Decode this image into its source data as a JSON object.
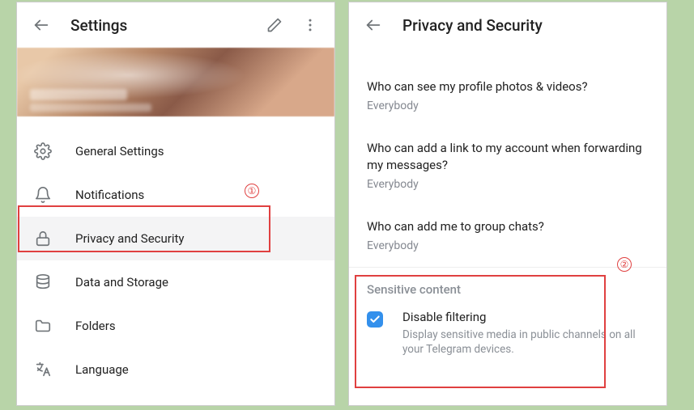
{
  "left": {
    "title": "Settings",
    "menu": [
      {
        "label": "General Settings"
      },
      {
        "label": "Notifications"
      },
      {
        "label": "Privacy and Security"
      },
      {
        "label": "Data and Storage"
      },
      {
        "label": "Folders"
      },
      {
        "label": "Language"
      }
    ]
  },
  "right": {
    "title": "Privacy and Security",
    "privacy": [
      {
        "title": "Who can see my profile photos & videos?",
        "value": "Everybody"
      },
      {
        "title": "Who can add a link to my account when forwarding my messages?",
        "value": "Everybody"
      },
      {
        "title": "Who can add me to group chats?",
        "value": "Everybody"
      }
    ],
    "sensitive": {
      "header": "Sensitive content",
      "title": "Disable filtering",
      "desc": "Display sensitive media in public channels on all your Telegram devices."
    }
  },
  "annotations": {
    "one": "①",
    "two": "②"
  }
}
